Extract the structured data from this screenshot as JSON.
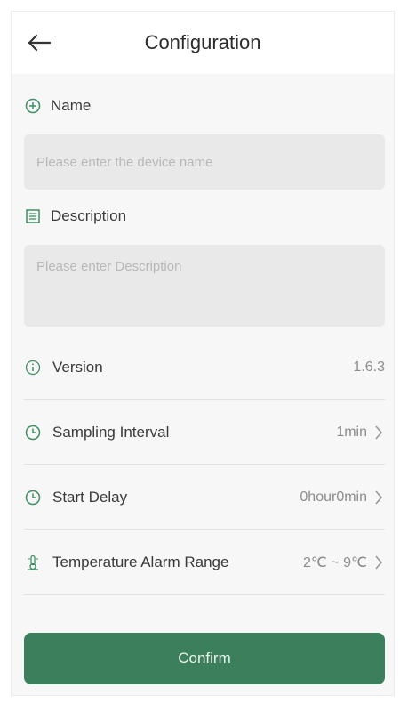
{
  "header": {
    "title": "Configuration"
  },
  "name_section": {
    "label": "Name",
    "placeholder": "Please enter the device name",
    "value": ""
  },
  "description_section": {
    "label": "Description",
    "placeholder": "Please enter Description",
    "value": ""
  },
  "settings": {
    "version": {
      "label": "Version",
      "value": "1.6.3"
    },
    "sampling_interval": {
      "label": "Sampling Interval",
      "value": "1min"
    },
    "start_delay": {
      "label": "Start Delay",
      "value": "0hour0min"
    },
    "temperature_alarm_range": {
      "label": "Temperature Alarm Range",
      "value": "2℃ ~ 9℃"
    }
  },
  "actions": {
    "confirm_label": "Confirm"
  },
  "colors": {
    "accent": "#3b7f5c",
    "icon_green": "#3f8f63",
    "background": "#f7f7f7",
    "field_background": "#e9e9e9"
  },
  "icons": {
    "back": "arrow-left-icon",
    "name": "plus-circle-icon",
    "description": "document-icon",
    "version": "info-circle-icon",
    "sampling_interval": "clock-icon",
    "start_delay": "clock-icon",
    "temperature_alarm_range": "thermometer-icon",
    "chevron": "chevron-right-icon"
  }
}
